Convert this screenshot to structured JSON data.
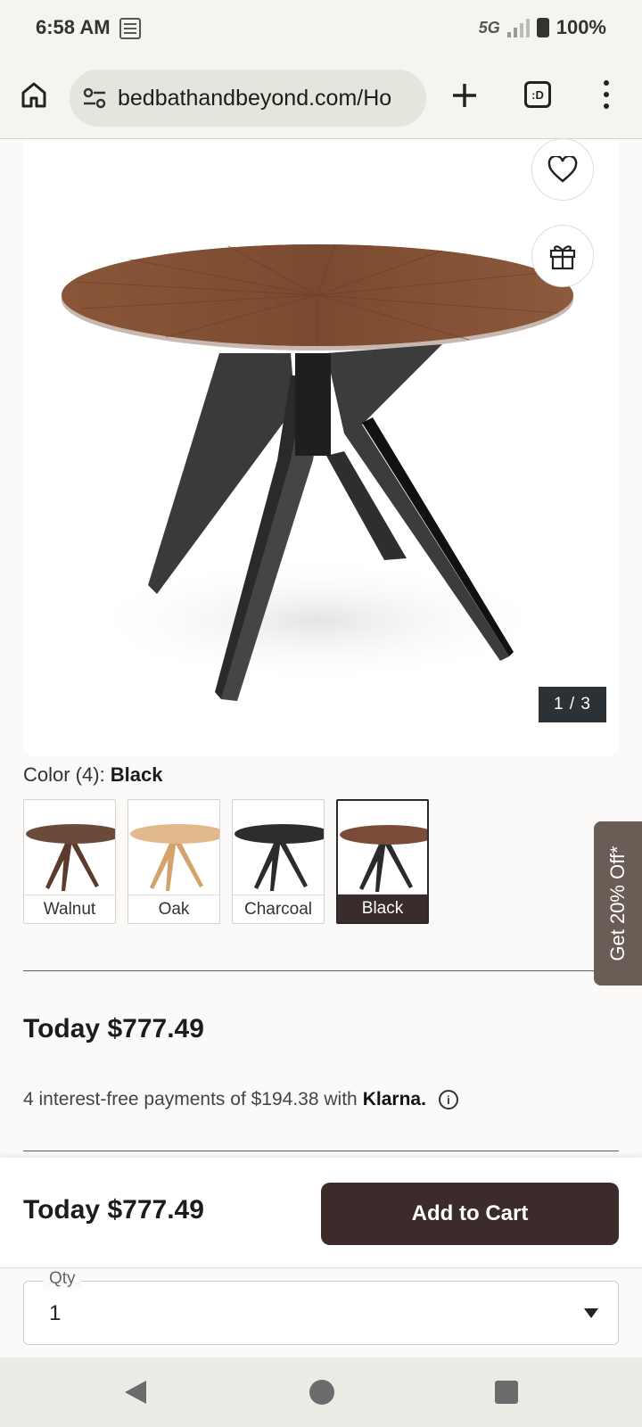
{
  "status_bar": {
    "time": "6:58 AM",
    "network": "5G",
    "battery": "100%"
  },
  "browser": {
    "url": "bedbathandbeyond.com/Ho",
    "tabs_icon_text": ":D"
  },
  "gallery": {
    "counter": "1 / 3"
  },
  "color_selector": {
    "label": "Color (4): ",
    "selected": "Black",
    "options": [
      {
        "label": "Walnut",
        "top_color": "#6b4a3a",
        "leg_color": "#5a3b2e"
      },
      {
        "label": "Oak",
        "top_color": "#e1b98a",
        "leg_color": "#d4a26b"
      },
      {
        "label": "Charcoal",
        "top_color": "#2d2d2d",
        "leg_color": "#2b2b2b"
      },
      {
        "label": "Black",
        "top_color": "#7a4c38",
        "leg_color": "#2b2b2b"
      }
    ]
  },
  "promo_tab": "Get 20% Off*",
  "pricing": {
    "price": "Today $777.49",
    "installments": "4 interest-free payments of $194.38 with",
    "klarna": "Klarna."
  },
  "sticky": {
    "price": "Today $777.49",
    "cart_button": "Add to Cart"
  },
  "quantity": {
    "label": "Qty",
    "value": "1"
  }
}
